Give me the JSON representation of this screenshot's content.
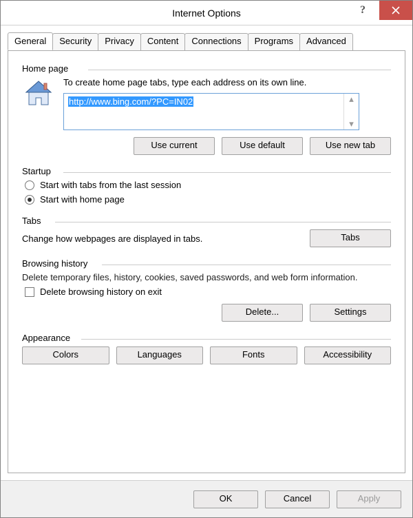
{
  "title": "Internet Options",
  "tabs": [
    "General",
    "Security",
    "Privacy",
    "Content",
    "Connections",
    "Programs",
    "Advanced"
  ],
  "active_tab": 0,
  "homepage": {
    "label": "Home page",
    "instruction": "To create home page tabs, type each address on its own line.",
    "url": "http://www.bing.com/?PC=IN02",
    "btn_use_current": "Use current",
    "btn_use_default": "Use default",
    "btn_use_new_tab": "Use new tab"
  },
  "startup": {
    "label": "Startup",
    "opt_last": "Start with tabs from the last session",
    "opt_home": "Start with home page",
    "selected": "home"
  },
  "tabs_section": {
    "label": "Tabs",
    "desc": "Change how webpages are displayed in tabs.",
    "btn": "Tabs"
  },
  "history": {
    "label": "Browsing history",
    "desc": "Delete temporary files, history, cookies, saved passwords, and web form information.",
    "chk": "Delete browsing history on exit",
    "btn_delete": "Delete...",
    "btn_settings": "Settings"
  },
  "appearance": {
    "label": "Appearance",
    "btn_colors": "Colors",
    "btn_languages": "Languages",
    "btn_fonts": "Fonts",
    "btn_accessibility": "Accessibility"
  },
  "footer": {
    "ok": "OK",
    "cancel": "Cancel",
    "apply": "Apply"
  }
}
